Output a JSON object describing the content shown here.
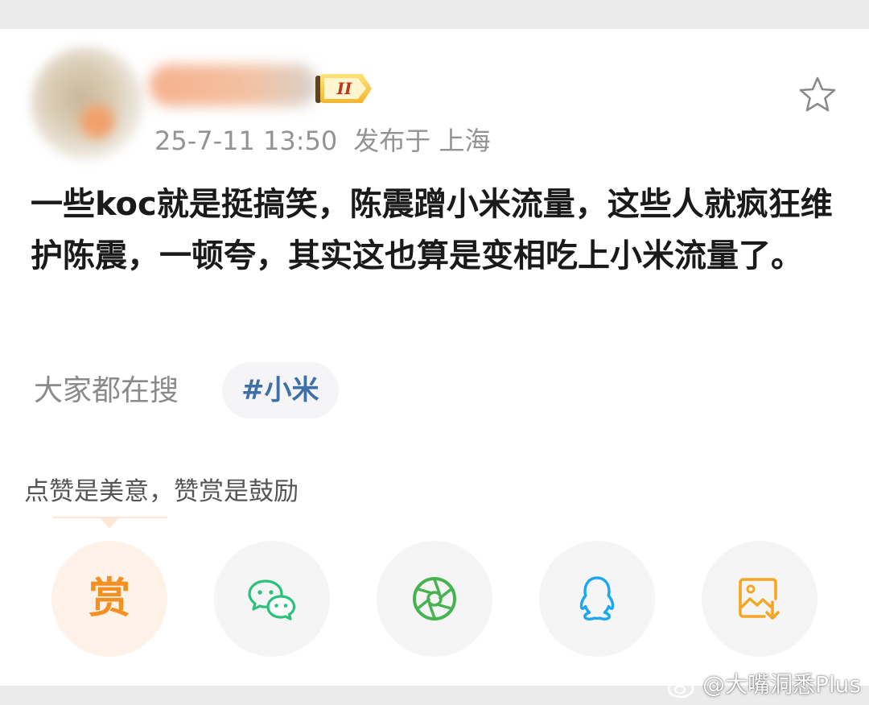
{
  "post": {
    "level_badge": "II",
    "timestamp": "25-7-11 13:50",
    "location": "发布于 上海",
    "text": "一些koc就是挺搞笑，陈震蹭小米流量，这些人就疯狂维护陈震，一顿夸，其实这也算是变相吃上小米流量了。"
  },
  "search": {
    "label": "大家都在搜",
    "tag": "#小米"
  },
  "reward": {
    "tip": "点赞是美意，赞赏是鼓励",
    "button_label": "赏"
  },
  "share_icons": [
    "reward-icon",
    "wechat-icon",
    "moments-icon",
    "qq-icon",
    "save-image-icon"
  ],
  "colors": {
    "reward": "#f39022",
    "wechat": "#2bc17b",
    "moments": "#45b34f",
    "qq": "#1aa6f0",
    "save": "#f5a623",
    "tag_text": "#3d6fa8"
  },
  "watermark": "@大嘴洞悉Plus"
}
